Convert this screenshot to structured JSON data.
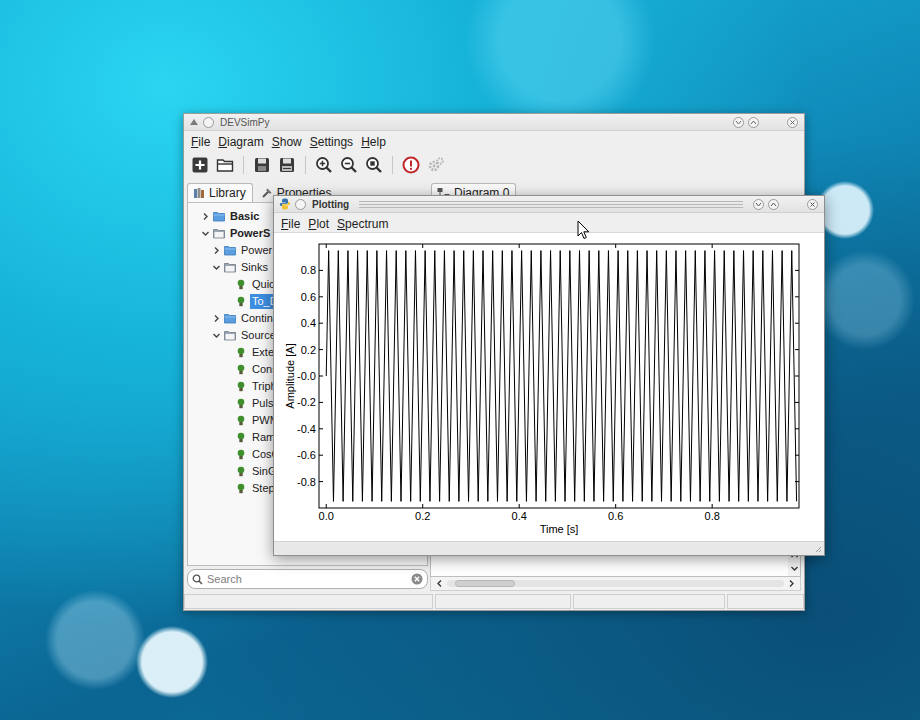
{
  "main_window": {
    "title": "DEVSimPy",
    "menu": [
      "File",
      "Diagram",
      "Show",
      "Settings",
      "Help"
    ],
    "toolbar": [
      {
        "disabled": false
      },
      {
        "disabled": false
      },
      {
        "disabled": false
      },
      {
        "disabled": false
      },
      {
        "disabled": false
      },
      {
        "disabled": false
      },
      {
        "disabled": false
      },
      {
        "disabled": false
      },
      {
        "disabled": true
      }
    ],
    "side_tabs": [
      {
        "label": "Library",
        "selected": true
      },
      {
        "label": "Properties",
        "selected": false
      }
    ],
    "tree": [
      {
        "label": "Basic",
        "kind": "folder",
        "expanded": false,
        "bold": true,
        "selected": false,
        "children": []
      },
      {
        "label": "PowerS",
        "kind": "folder",
        "expanded": true,
        "bold": true,
        "selected": false,
        "children": [
          {
            "label": "Power",
            "kind": "folder",
            "expanded": false,
            "bold": false,
            "selected": false,
            "children": []
          },
          {
            "label": "Sinks",
            "kind": "folder",
            "expanded": true,
            "bold": false,
            "selected": false,
            "children": [
              {
                "label": "Quic",
                "kind": "model",
                "expanded": false,
                "bold": false,
                "selected": false,
                "children": []
              },
              {
                "label": "To_D",
                "kind": "model",
                "expanded": false,
                "bold": false,
                "selected": true,
                "children": []
              }
            ]
          },
          {
            "label": "Contin",
            "kind": "folder",
            "expanded": false,
            "bold": false,
            "selected": false,
            "children": []
          },
          {
            "label": "Source",
            "kind": "folder",
            "expanded": true,
            "bold": false,
            "selected": false,
            "children": [
              {
                "label": "Exte",
                "kind": "model",
                "expanded": false,
                "bold": false,
                "selected": false,
                "children": []
              },
              {
                "label": "Cons",
                "kind": "model",
                "expanded": false,
                "bold": false,
                "selected": false,
                "children": []
              },
              {
                "label": "Triph",
                "kind": "model",
                "expanded": false,
                "bold": false,
                "selected": false,
                "children": []
              },
              {
                "label": "Pulse",
                "kind": "model",
                "expanded": false,
                "bold": false,
                "selected": false,
                "children": []
              },
              {
                "label": "PWM",
                "kind": "model",
                "expanded": false,
                "bold": false,
                "selected": false,
                "children": []
              },
              {
                "label": "Ram",
                "kind": "model",
                "expanded": false,
                "bold": false,
                "selected": false,
                "children": []
              },
              {
                "label": "CosG",
                "kind": "model",
                "expanded": false,
                "bold": false,
                "selected": false,
                "children": []
              },
              {
                "label": "SinG",
                "kind": "model",
                "expanded": false,
                "bold": false,
                "selected": false,
                "children": []
              },
              {
                "label": "Step",
                "kind": "model",
                "expanded": false,
                "bold": false,
                "selected": false,
                "children": []
              }
            ]
          }
        ]
      }
    ],
    "search": {
      "placeholder": "Search"
    },
    "diagram_tabs": [
      {
        "label": "Diagram 0",
        "selected": true
      }
    ]
  },
  "plot_window": {
    "title": "Plotting",
    "menu": [
      "File",
      "Plot",
      "Spectrum"
    ],
    "chart": {
      "x_axis": {
        "label": "Time [s]",
        "range": [
          -0.015,
          0.98
        ],
        "ticks": [
          {
            "label": "0.0",
            "value": 0
          },
          {
            "label": "0.2",
            "value": 0.2
          },
          {
            "label": "0.4",
            "value": 0.4
          },
          {
            "label": "0.6",
            "value": 0.6
          },
          {
            "label": "0.8",
            "value": 0.8
          }
        ]
      },
      "y_axis": {
        "label": "Amplitude [A]",
        "range": [
          -1,
          1
        ],
        "ticks": [
          {
            "label": "0.8",
            "value": 0.8
          },
          {
            "label": "0.6",
            "value": 0.6
          },
          {
            "label": "0.4",
            "value": 0.4
          },
          {
            "label": "0.2",
            "value": 0.2
          },
          {
            "label": "-0.0",
            "value": 0
          },
          {
            "label": "-0.2",
            "value": -0.2
          },
          {
            "label": "-0.4",
            "value": -0.4
          },
          {
            "label": "-0.6",
            "value": -0.6
          },
          {
            "label": "-0.8",
            "value": -0.8
          }
        ]
      },
      "series": [
        {
          "t0": 0,
          "dt": 0.005,
          "values": [
            0,
            0.95,
            0,
            -0.95,
            0,
            0.95,
            0,
            -0.95,
            0,
            0.95,
            0,
            -0.95,
            0,
            0.95,
            0,
            -0.95,
            0,
            0.95,
            0,
            -0.95,
            0,
            0.95,
            0,
            -0.95,
            0,
            0.95,
            0,
            -0.95,
            0,
            0.95,
            0,
            -0.95,
            0,
            0.95,
            0,
            -0.95,
            0,
            0.95,
            0,
            -0.95,
            0,
            0.95,
            0,
            -0.95,
            0,
            0.95,
            0,
            -0.95,
            0,
            0.95,
            0,
            -0.95,
            0,
            0.95,
            0,
            -0.95,
            0,
            0.95,
            0,
            -0.95,
            0,
            0.95,
            0,
            -0.95,
            0,
            0.95,
            0,
            -0.95,
            0,
            0.95,
            0,
            -0.95,
            0,
            0.95,
            0,
            -0.95,
            0,
            0.95,
            0,
            -0.95,
            0,
            0.95,
            0,
            -0.95,
            0,
            0.95,
            0,
            -0.95,
            0,
            0.95,
            0,
            -0.95,
            0,
            0.95,
            0,
            -0.95,
            0,
            0.95,
            0,
            -0.95,
            0,
            0.95,
            0,
            -0.95,
            0,
            0.95,
            0,
            -0.95,
            0,
            0.95,
            0,
            -0.95,
            0,
            0.95,
            0,
            -0.95,
            0,
            0.95,
            0,
            -0.95,
            0,
            0.95,
            0,
            -0.95,
            0,
            0.95,
            0,
            -0.95,
            0,
            0.95,
            0,
            -0.95,
            0,
            0.95,
            0,
            -0.95,
            0,
            0.95,
            0,
            -0.95,
            0,
            0.95,
            0,
            -0.95,
            0,
            0.95,
            0,
            -0.95,
            0,
            0.95,
            0,
            -0.95,
            0,
            0.95,
            0,
            -0.95,
            0,
            0.95,
            0,
            -0.95,
            0,
            0.95,
            0,
            -0.95,
            0,
            0.95,
            0,
            -0.95,
            0,
            0.95,
            0,
            -0.95,
            0,
            0.95,
            0,
            -0.95,
            0,
            0.95,
            0,
            -0.95,
            0,
            0.95,
            0,
            -0.95,
            0,
            0.95,
            0,
            -0.95,
            0,
            0.95,
            0,
            -0.95,
            0,
            0.95,
            0,
            -0.95
          ]
        }
      ]
    }
  }
}
